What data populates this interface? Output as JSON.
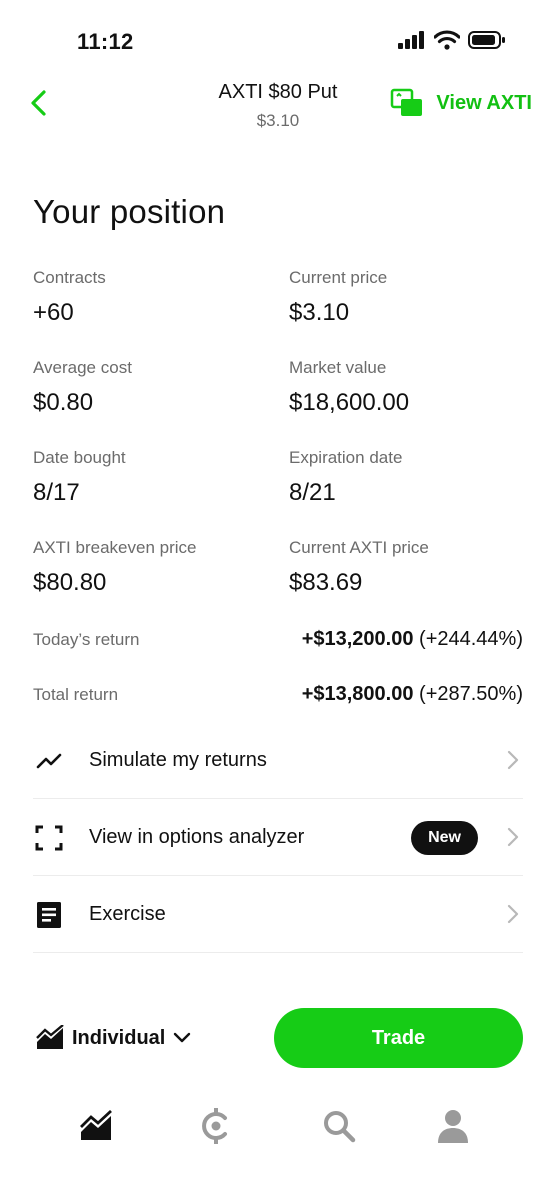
{
  "status_bar": {
    "time": "11:12"
  },
  "header": {
    "title": "AXTI $80 Put",
    "subtitle": "$3.10",
    "view_link": "View AXTI"
  },
  "position": {
    "title": "Your position",
    "stats": [
      {
        "label": "Contracts",
        "value": "+60"
      },
      {
        "label": "Current price",
        "value": "$3.10"
      },
      {
        "label": "Average cost",
        "value": "$0.80"
      },
      {
        "label": "Market value",
        "value": "$18,600.00"
      },
      {
        "label": "Date bought",
        "value": "8/17"
      },
      {
        "label": "Expiration date",
        "value": "8/21"
      },
      {
        "label": "AXTI breakeven price",
        "value": "$80.80"
      },
      {
        "label": "Current AXTI price",
        "value": "$83.69"
      }
    ],
    "todays_return": {
      "label": "Today’s return",
      "amount": "+$13,200.00",
      "percent": "(+244.44%)"
    },
    "total_return": {
      "label": "Total return",
      "amount": "+$13,800.00",
      "percent": "(+287.50%)"
    }
  },
  "menu": [
    {
      "label": "Simulate my returns",
      "icon": "trend-line-icon"
    },
    {
      "label": "View in options analyzer",
      "icon": "analyzer-frame-icon",
      "badge": "New"
    },
    {
      "label": "Exercise",
      "icon": "document-icon"
    }
  ],
  "bottom": {
    "account": "Individual",
    "trade_button": "Trade"
  },
  "tabbar": [
    "investing-tab",
    "crypto-tab",
    "search-tab",
    "account-tab"
  ],
  "colors": {
    "accent": "#16cc16",
    "text": "#111111",
    "muted": "#6b6b6b"
  }
}
